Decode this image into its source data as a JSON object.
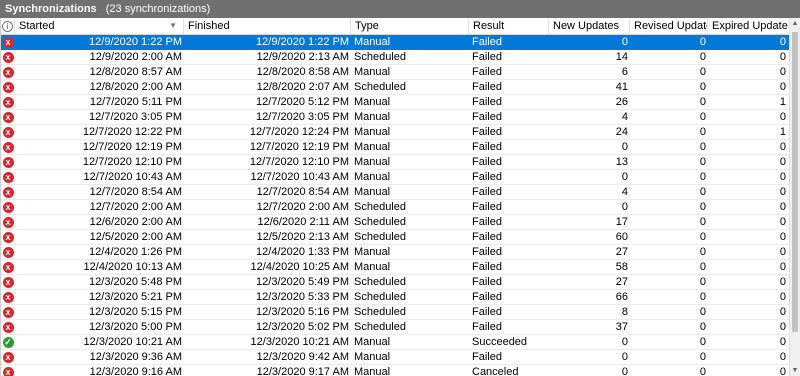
{
  "title": "Synchronizations",
  "subtitle": "(23 synchronizations)",
  "columns": {
    "icon": "i",
    "started": "Started",
    "finished": "Finished",
    "type": "Type",
    "result": "Result",
    "new": "New Updates",
    "revised": "Revised Updates",
    "expired": "Expired Updates"
  },
  "icons": {
    "failed": "x",
    "succeeded": "✓",
    "canceled": "x"
  },
  "colors": {
    "title_bg": "#707070",
    "selection": "#0078d7",
    "failed": "#d9262e",
    "succeeded": "#2e9b32"
  },
  "rows": [
    {
      "status": "failed",
      "started": "12/9/2020 1:22 PM",
      "finished": "12/9/2020 1:22 PM",
      "type": "Manual",
      "result": "Failed",
      "new": "0",
      "revised": "0",
      "expired": "0",
      "selected": true
    },
    {
      "status": "failed",
      "started": "12/9/2020 2:00 AM",
      "finished": "12/9/2020 2:13 AM",
      "type": "Scheduled",
      "result": "Failed",
      "new": "14",
      "revised": "0",
      "expired": "0"
    },
    {
      "status": "failed",
      "started": "12/8/2020 8:57 AM",
      "finished": "12/8/2020 8:58 AM",
      "type": "Manual",
      "result": "Failed",
      "new": "6",
      "revised": "0",
      "expired": "0"
    },
    {
      "status": "failed",
      "started": "12/8/2020 2:00 AM",
      "finished": "12/8/2020 2:07 AM",
      "type": "Scheduled",
      "result": "Failed",
      "new": "41",
      "revised": "0",
      "expired": "0"
    },
    {
      "status": "failed",
      "started": "12/7/2020 5:11 PM",
      "finished": "12/7/2020 5:12 PM",
      "type": "Manual",
      "result": "Failed",
      "new": "26",
      "revised": "0",
      "expired": "1"
    },
    {
      "status": "failed",
      "started": "12/7/2020 3:05 PM",
      "finished": "12/7/2020 3:05 PM",
      "type": "Manual",
      "result": "Failed",
      "new": "4",
      "revised": "0",
      "expired": "0"
    },
    {
      "status": "failed",
      "started": "12/7/2020 12:22 PM",
      "finished": "12/7/2020 12:24 PM",
      "type": "Manual",
      "result": "Failed",
      "new": "24",
      "revised": "0",
      "expired": "1"
    },
    {
      "status": "failed",
      "started": "12/7/2020 12:19 PM",
      "finished": "12/7/2020 12:19 PM",
      "type": "Manual",
      "result": "Failed",
      "new": "0",
      "revised": "0",
      "expired": "0"
    },
    {
      "status": "failed",
      "started": "12/7/2020 12:10 PM",
      "finished": "12/7/2020 12:10 PM",
      "type": "Manual",
      "result": "Failed",
      "new": "13",
      "revised": "0",
      "expired": "0"
    },
    {
      "status": "failed",
      "started": "12/7/2020 10:43 AM",
      "finished": "12/7/2020 10:43 AM",
      "type": "Manual",
      "result": "Failed",
      "new": "0",
      "revised": "0",
      "expired": "0"
    },
    {
      "status": "failed",
      "started": "12/7/2020 8:54 AM",
      "finished": "12/7/2020 8:54 AM",
      "type": "Manual",
      "result": "Failed",
      "new": "4",
      "revised": "0",
      "expired": "0"
    },
    {
      "status": "failed",
      "started": "12/7/2020 2:00 AM",
      "finished": "12/7/2020 2:00 AM",
      "type": "Scheduled",
      "result": "Failed",
      "new": "0",
      "revised": "0",
      "expired": "0"
    },
    {
      "status": "failed",
      "started": "12/6/2020 2:00 AM",
      "finished": "12/6/2020 2:11 AM",
      "type": "Scheduled",
      "result": "Failed",
      "new": "17",
      "revised": "0",
      "expired": "0"
    },
    {
      "status": "failed",
      "started": "12/5/2020 2:00 AM",
      "finished": "12/5/2020 2:13 AM",
      "type": "Scheduled",
      "result": "Failed",
      "new": "60",
      "revised": "0",
      "expired": "0"
    },
    {
      "status": "failed",
      "started": "12/4/2020 1:26 PM",
      "finished": "12/4/2020 1:33 PM",
      "type": "Manual",
      "result": "Failed",
      "new": "27",
      "revised": "0",
      "expired": "0"
    },
    {
      "status": "failed",
      "started": "12/4/2020 10:13 AM",
      "finished": "12/4/2020 10:25 AM",
      "type": "Manual",
      "result": "Failed",
      "new": "58",
      "revised": "0",
      "expired": "0"
    },
    {
      "status": "failed",
      "started": "12/3/2020 5:48 PM",
      "finished": "12/3/2020 5:49 PM",
      "type": "Scheduled",
      "result": "Failed",
      "new": "27",
      "revised": "0",
      "expired": "0"
    },
    {
      "status": "failed",
      "started": "12/3/2020 5:21 PM",
      "finished": "12/3/2020 5:33 PM",
      "type": "Scheduled",
      "result": "Failed",
      "new": "66",
      "revised": "0",
      "expired": "0"
    },
    {
      "status": "failed",
      "started": "12/3/2020 5:15 PM",
      "finished": "12/3/2020 5:16 PM",
      "type": "Scheduled",
      "result": "Failed",
      "new": "8",
      "revised": "0",
      "expired": "0"
    },
    {
      "status": "failed",
      "started": "12/3/2020 5:00 PM",
      "finished": "12/3/2020 5:02 PM",
      "type": "Scheduled",
      "result": "Failed",
      "new": "37",
      "revised": "0",
      "expired": "0"
    },
    {
      "status": "succeeded",
      "started": "12/3/2020 10:21 AM",
      "finished": "12/3/2020 10:21 AM",
      "type": "Manual",
      "result": "Succeeded",
      "new": "0",
      "revised": "0",
      "expired": "0"
    },
    {
      "status": "failed",
      "started": "12/3/2020 9:36 AM",
      "finished": "12/3/2020 9:42 AM",
      "type": "Manual",
      "result": "Failed",
      "new": "0",
      "revised": "0",
      "expired": "0"
    },
    {
      "status": "canceled",
      "started": "12/3/2020 9:16 AM",
      "finished": "12/3/2020 9:17 AM",
      "type": "Manual",
      "result": "Canceled",
      "new": "0",
      "revised": "0",
      "expired": "0"
    }
  ]
}
